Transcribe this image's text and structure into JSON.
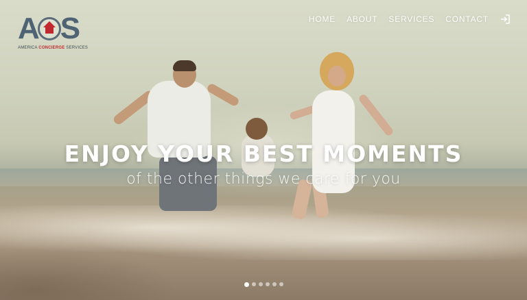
{
  "logo": {
    "mark_left": "A",
    "mark_right": "S",
    "tagline_part1": "AMERICA",
    "tagline_part2": "CONCIERGE",
    "tagline_part3": "SERVICES",
    "brand_red": "#c0292f",
    "brand_slate": "#4e6374"
  },
  "nav": {
    "items": [
      {
        "label": "HOME"
      },
      {
        "label": "ABOUT"
      },
      {
        "label": "SERVICES"
      },
      {
        "label": "CONTACT"
      }
    ],
    "login_icon": "sign-in-icon"
  },
  "hero": {
    "headline": "ENJOY YOUR BEST MOMENTS",
    "subline": "of the other things we care for you"
  },
  "slider": {
    "slide_count": 6,
    "active_index": 0
  }
}
